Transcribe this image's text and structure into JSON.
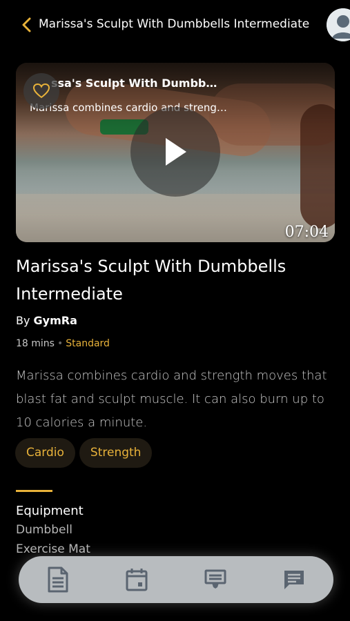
{
  "header": {
    "title": "Marissa's Sculpt With Dumbbells Intermediate"
  },
  "video": {
    "overlay_title": "ssa's Sculpt With Dumbb…",
    "overlay_subtitle": "Marissa combines cardio and streng…",
    "duration": "07:04"
  },
  "workout": {
    "title": "Marissa's Sculpt With Dumbbells Intermediate",
    "by_prefix": "By",
    "author": "GymRa",
    "duration": "18 mins",
    "separator": "•",
    "level": "Standard",
    "description": "Marissa combines cardio and strength moves that blast fat and sculpt muscle. It can also burn up to 10 calories a minute.",
    "tags": [
      "Cardio",
      "Strength"
    ]
  },
  "equipment": {
    "heading": "Equipment",
    "items": [
      "Dumbbell",
      "Exercise Mat"
    ]
  },
  "tabbar": {
    "icons": [
      "document-icon",
      "calendar-icon",
      "board-icon",
      "chat-icon"
    ]
  },
  "colors": {
    "accent": "#e8b23a",
    "background": "#000000",
    "tabbar": "#b8bcbf"
  }
}
